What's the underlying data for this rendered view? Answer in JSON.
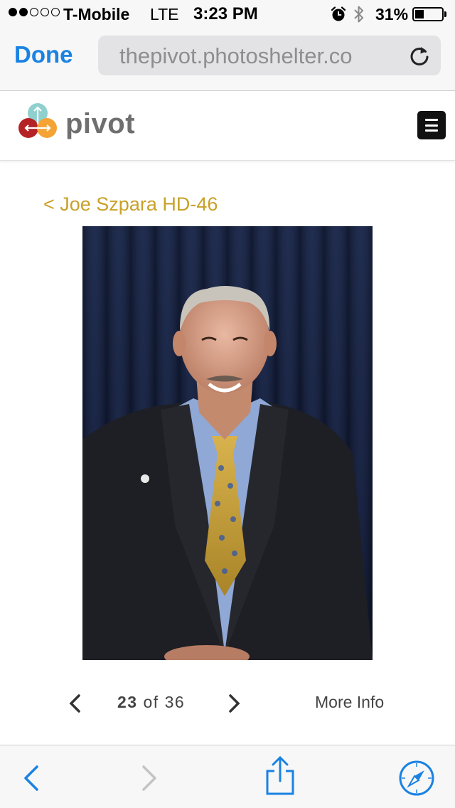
{
  "status_bar": {
    "signal_filled": 2,
    "signal_total": 5,
    "carrier": "T-Mobile",
    "network": "LTE",
    "time": "3:23 PM",
    "battery_percent": "31%"
  },
  "browser": {
    "done_label": "Done",
    "url": "thepivot.photoshelter.co",
    "accent_color": "#1a82e2"
  },
  "site": {
    "logo_text": "pivot",
    "menu_icon": "hamburger-menu-icon"
  },
  "gallery": {
    "back_link": "< Joe Szpara HD-46",
    "back_link_color": "#c9a129",
    "current": "23",
    "of_label": "of",
    "total": "36",
    "more_info_label": "More Info"
  },
  "toolbar": {
    "icons": [
      "back-chevron-icon",
      "forward-chevron-icon",
      "share-icon",
      "safari-compass-icon"
    ]
  }
}
